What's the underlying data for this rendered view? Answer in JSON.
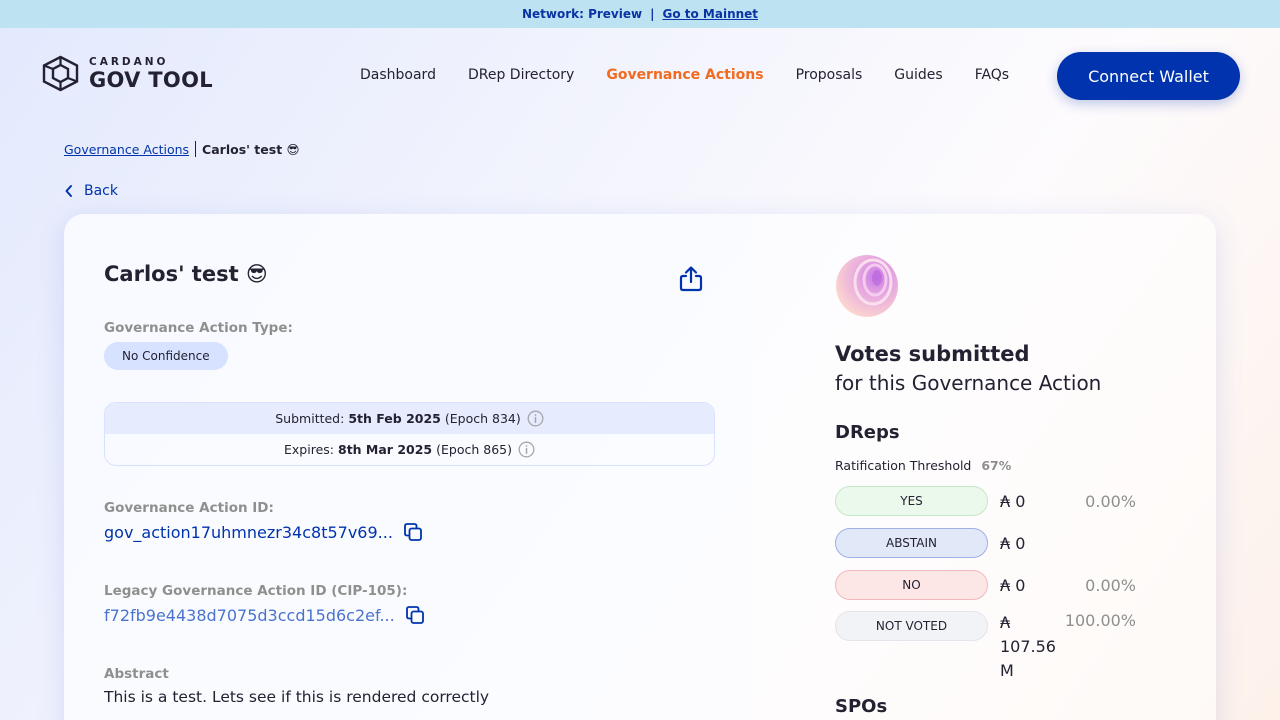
{
  "banner": {
    "network": "Network: Preview",
    "separator": "|",
    "link": "Go to Mainnet"
  },
  "logo": {
    "small": "CARDANO",
    "big": "GOV TOOL"
  },
  "nav": {
    "items": [
      "Dashboard",
      "DRep Directory",
      "Governance Actions",
      "Proposals",
      "Guides",
      "FAQs"
    ],
    "active": "Governance Actions",
    "connect": "Connect Wallet"
  },
  "breadcrumb": {
    "parent": "Governance Actions",
    "current": "Carlos' test 😎"
  },
  "back": "Back",
  "action": {
    "title": "Carlos' test 😎",
    "type_label": "Governance Action Type:",
    "type_value": "No Confidence",
    "submitted": {
      "label": "Submitted:",
      "date": "5th Feb 2025",
      "epoch": "(Epoch 834)"
    },
    "expires": {
      "label": "Expires:",
      "date": "8th Mar 2025",
      "epoch": "(Epoch 865)"
    },
    "id_label": "Governance Action ID:",
    "id_value": "gov_action17uhmnezr34c8t57v69...",
    "legacy_label": "Legacy Governance Action ID (CIP-105):",
    "legacy_value": "f72fb9e4438d7075d3ccd15d6c2ef...",
    "abstract_label": "Abstract",
    "abstract_text": "This is a test. Lets see if this is rendered correctly"
  },
  "votes": {
    "title": "Votes submitted",
    "subtitle": "for this Governance Action",
    "dreps_title": "DReps",
    "threshold_label": "Ratification Threshold",
    "threshold_value": "67%",
    "rows": [
      {
        "label": "YES",
        "amount": "₳ 0",
        "percent": "0.00%"
      },
      {
        "label": "ABSTAIN",
        "amount": "₳ 0",
        "percent": ""
      },
      {
        "label": "NO",
        "amount": "₳ 0",
        "percent": "0.00%"
      },
      {
        "label": "NOT VOTED",
        "amount": "₳ 107.56 M",
        "percent": "100.00%"
      }
    ],
    "spos_title": "SPOs"
  },
  "colors": {
    "primary": "#0033ad",
    "accent": "#f26a1f",
    "banner": "#bde3f2",
    "text": "#242232",
    "muted": "#8e908e"
  },
  "icons": [
    "logo-hexagon-icon",
    "chevron-left-icon",
    "share-icon",
    "info-icon",
    "copy-icon",
    "orb-icon"
  ]
}
